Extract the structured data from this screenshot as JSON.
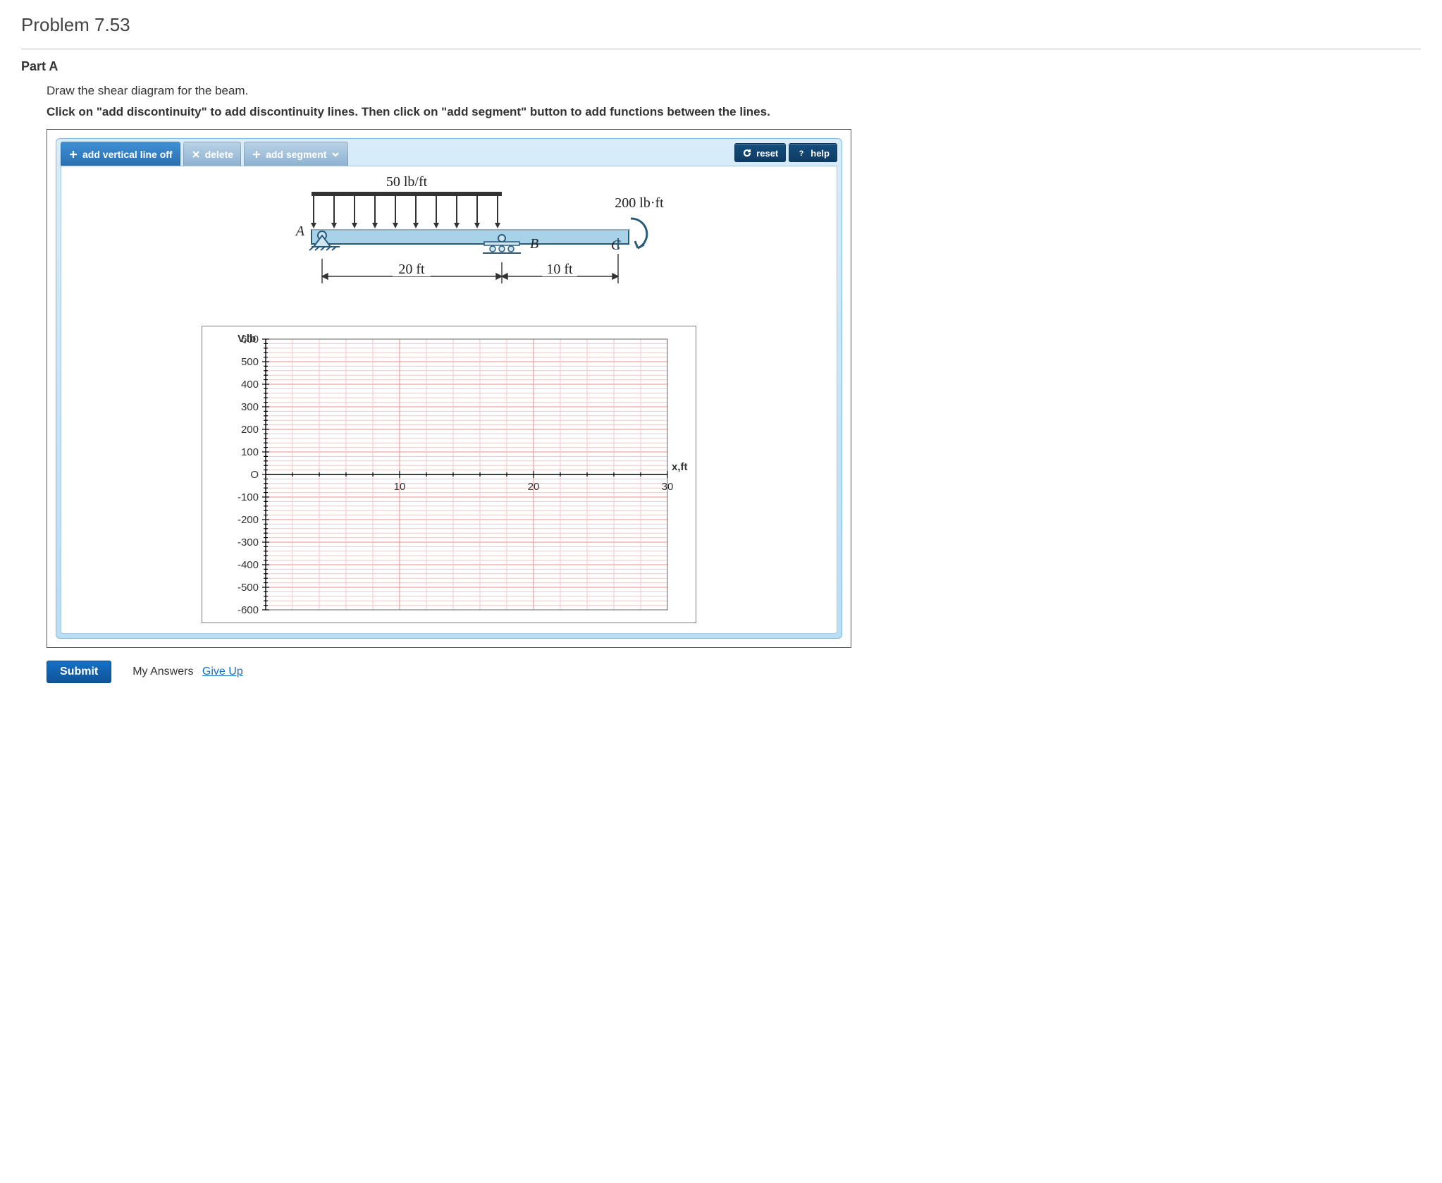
{
  "problem_title": "Problem 7.53",
  "part_label": "Part A",
  "instruction1": "Draw the shear diagram for the beam.",
  "instruction2": "Click on \"add discontinuity\" to add discontinuity lines. Then click on \"add segment\" button to add functions between the lines.",
  "toolbar": {
    "add_vertical": "add vertical line off",
    "delete": "delete",
    "add_segment": "add segment",
    "reset": "reset",
    "help": "help"
  },
  "beam": {
    "load_dist": "50 lb/ft",
    "moment": "200 lb·ft",
    "pt_A": "A",
    "pt_B": "B",
    "pt_C": "C",
    "dim1": "20 ft",
    "dim2": "10 ft"
  },
  "chart_data": {
    "type": "line",
    "title": "",
    "ylabel": "V,lb",
    "xlabel": "x,ft",
    "xlim": [
      0,
      30
    ],
    "ylim": [
      -600,
      600
    ],
    "xticks": [
      0,
      10,
      20,
      30
    ],
    "yticks": [
      -600,
      -500,
      -400,
      -300,
      -200,
      -100,
      0,
      100,
      200,
      300,
      400,
      500,
      600
    ],
    "xtick_labels": [
      "",
      "10",
      "20",
      "30"
    ],
    "ytick_labels": [
      "-600",
      "-500",
      "-400",
      "-300",
      "-200",
      "-100",
      "O",
      "100",
      "200",
      "300",
      "400",
      "500",
      "600"
    ],
    "series": []
  },
  "submit": {
    "submit_label": "Submit",
    "my_answers": "My Answers",
    "give_up": "Give Up"
  }
}
